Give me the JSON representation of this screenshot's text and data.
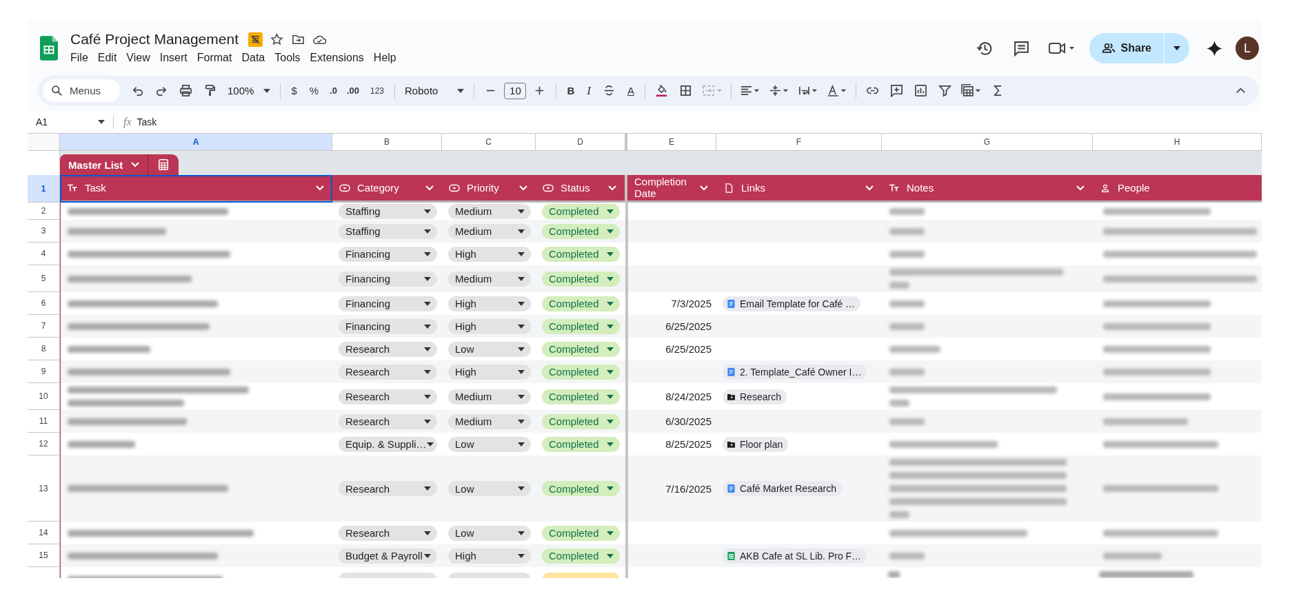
{
  "document": {
    "title": "Café Project Management"
  },
  "menu": [
    "File",
    "Edit",
    "View",
    "Insert",
    "Format",
    "Data",
    "Tools",
    "Extensions",
    "Help"
  ],
  "share": {
    "label": "Share"
  },
  "account": {
    "initial": "L"
  },
  "toolbar": {
    "search": "Menus",
    "zoom": "100%",
    "currency": "$",
    "percent": "%",
    "decrease_decimals": ".0",
    "increase_decimals": ".00",
    "number_format": "123",
    "font": "Roboto",
    "font_size": "10",
    "bold": "B",
    "italic": "I",
    "text_color": "A"
  },
  "formula_bar": {
    "cell": "A1",
    "fx": "fx",
    "content": "Task"
  },
  "columns": [
    {
      "letter": "A",
      "selected": true
    },
    {
      "letter": "B",
      "selected": false
    },
    {
      "letter": "C",
      "selected": false
    },
    {
      "letter": "D",
      "selected": false
    },
    {
      "letter": "E",
      "selected": false
    },
    {
      "letter": "F",
      "selected": false
    },
    {
      "letter": "G",
      "selected": false
    },
    {
      "letter": "H",
      "selected": false
    }
  ],
  "table": {
    "name": "Master List",
    "header_row": "1",
    "header_selected": true,
    "headers": [
      {
        "label": "Task",
        "kind": "text",
        "chevron": true
      },
      {
        "label": "Category",
        "kind": "dropdown",
        "chevron": true
      },
      {
        "label": "Priority",
        "kind": "dropdown",
        "chevron": true
      },
      {
        "label": "Status",
        "kind": "dropdown",
        "chevron": true
      },
      {
        "label": "Completion Date",
        "kind": "date",
        "chevron": true
      },
      {
        "label": "Links",
        "kind": "file",
        "chevron": true
      },
      {
        "label": "Notes",
        "kind": "text",
        "chevron": true
      },
      {
        "label": "People",
        "kind": "person",
        "chevron": false
      }
    ],
    "rows": [
      {
        "row": "2",
        "category": "Staffing",
        "priority": "Medium",
        "status": {
          "label": "Completed",
          "color": "#d4edbc"
        }
      },
      {
        "row": "3",
        "category": "Staffing",
        "priority": "Medium",
        "status": {
          "label": "Completed",
          "color": "#d4edbc"
        }
      },
      {
        "row": "4",
        "category": "Financing",
        "priority": "High",
        "status": {
          "label": "Completed",
          "color": "#d4edbc"
        }
      },
      {
        "row": "5",
        "category": "Financing",
        "priority": "Medium",
        "status": {
          "label": "Completed",
          "color": "#d4edbc"
        }
      },
      {
        "row": "6",
        "category": "Financing",
        "priority": "High",
        "status": {
          "label": "Completed",
          "color": "#d4edbc"
        },
        "date": "7/3/2025",
        "link": {
          "text": "Email Template for Café …",
          "kind": "doc"
        }
      },
      {
        "row": "7",
        "category": "Financing",
        "priority": "High",
        "status": {
          "label": "Completed",
          "color": "#d4edbc"
        },
        "date": "6/25/2025"
      },
      {
        "row": "8",
        "category": "Research",
        "priority": "Low",
        "status": {
          "label": "Completed",
          "color": "#d4edbc"
        },
        "date": "6/25/2025"
      },
      {
        "row": "9",
        "category": "Research",
        "priority": "High",
        "status": {
          "label": "Completed",
          "color": "#d4edbc"
        },
        "link": {
          "text": "2. Template_Café Owner I…",
          "kind": "doc"
        }
      },
      {
        "row": "10",
        "category": "Research",
        "priority": "Medium",
        "status": {
          "label": "Completed",
          "color": "#d4edbc"
        },
        "date": "8/24/2025",
        "link": {
          "text": "Research",
          "kind": "folder"
        }
      },
      {
        "row": "11",
        "category": "Research",
        "priority": "Medium",
        "status": {
          "label": "Completed",
          "color": "#d4edbc"
        },
        "date": "6/30/2025"
      },
      {
        "row": "12",
        "category": "Equip. & Suppli…",
        "priority": "Low",
        "status": {
          "label": "Completed",
          "color": "#d4edbc"
        },
        "date": "8/25/2025",
        "link": {
          "text": "Floor plan",
          "kind": "folder"
        }
      },
      {
        "row": "13",
        "category": "Research",
        "priority": "Low",
        "status": {
          "label": "Completed",
          "color": "#d4edbc"
        },
        "date": "7/16/2025",
        "link": {
          "text": "Café Market Research",
          "kind": "doc"
        }
      },
      {
        "row": "14",
        "category": "Research",
        "priority": "Low",
        "status": {
          "label": "Completed",
          "color": "#d4edbc"
        }
      },
      {
        "row": "15",
        "category": "Budget & Payroll",
        "priority": "High",
        "status": {
          "label": "Completed",
          "color": "#d4edbc"
        },
        "link": {
          "text": "AKB Cafe at SL Lib. Pro F…",
          "kind": "sheet"
        }
      }
    ],
    "cut_row": {
      "status": {
        "color": "#ffe39e"
      }
    }
  }
}
